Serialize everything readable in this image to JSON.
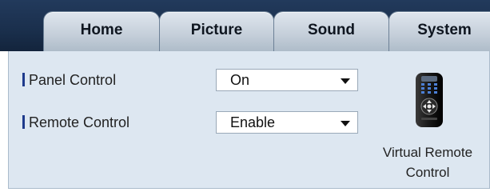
{
  "tabs": [
    {
      "label": "Home"
    },
    {
      "label": "Picture"
    },
    {
      "label": "Sound"
    },
    {
      "label": "System"
    }
  ],
  "settings": {
    "panel_control": {
      "label": "Panel Control",
      "value": "On"
    },
    "remote_control": {
      "label": "Remote Control",
      "value": "Enable"
    }
  },
  "virtual_remote": {
    "line1": "Virtual Remote",
    "line2": "Control",
    "icon": "remote-control-icon"
  },
  "colors": {
    "tabbar": "#1a2f4c",
    "panel": "#dde7f1",
    "accent": "#1e3a8c"
  }
}
